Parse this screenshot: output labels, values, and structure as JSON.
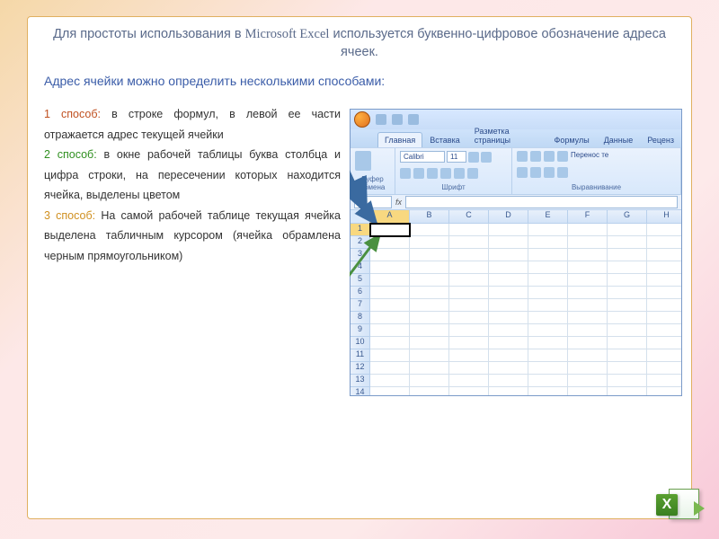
{
  "title_part1": "Для простоты использования в ",
  "title_app": "Microsoft Excel",
  "title_part2": "  используется  буквенно-цифровое обозначение адреса  ячеек.",
  "subtitle": "Адрес ячейки можно определить несколькими способами:",
  "methods": {
    "m1_label": "1 способ:",
    "m1_text": " в строке формул, в левой ее части отражается адрес текущей ячейки",
    "m2_label": "2 способ:",
    "m2_text": "  в окне рабочей таблицы буква столбца и цифра строки, на пересечении которых находится ячейка,  выделены цветом",
    "m3_label": "3 способ:",
    "m3_text": " На самой рабочей таблице текущая ячейка выделена табличным курсором (ячейка обрамлена черным прямоугольником)"
  },
  "excel": {
    "tabs": [
      "Главная",
      "Вставка",
      "Разметка страницы",
      "Формулы",
      "Данные",
      "Реценз"
    ],
    "active_tab": 0,
    "font_name": "Calibri",
    "font_size": "11",
    "groups": [
      "Буфер обмена",
      "Шрифт",
      "Выравнивание"
    ],
    "wrap_label": "Перенос те",
    "namebox": "A1",
    "columns": [
      "A",
      "B",
      "C",
      "D",
      "E",
      "F",
      "G",
      "H"
    ],
    "rows": [
      "1",
      "2",
      "3",
      "4",
      "5",
      "6",
      "7",
      "8",
      "9",
      "10",
      "11",
      "12",
      "13",
      "14"
    ],
    "active_cell": "A1"
  }
}
